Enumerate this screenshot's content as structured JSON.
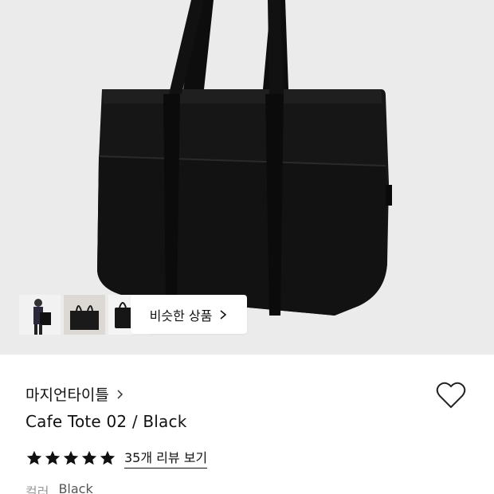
{
  "gallery": {
    "thumbnails": [
      {
        "icon": "model-photo-thumb"
      },
      {
        "icon": "bag-flat-photo-thumb"
      },
      {
        "icon": "bag-angle-photo-thumb"
      }
    ],
    "similar_button_label": "비슷한 상품"
  },
  "product": {
    "brand": "마지언타이틀",
    "title": "Cafe Tote 02 / Black",
    "rating_stars": 5,
    "review_link": "35개 리뷰 보기",
    "color_label": "컬러",
    "color_value": "Black"
  },
  "colors": {
    "hero_background": "#ebebeb",
    "bag": "#161616",
    "text_primary": "#111111",
    "text_muted": "#999999"
  }
}
